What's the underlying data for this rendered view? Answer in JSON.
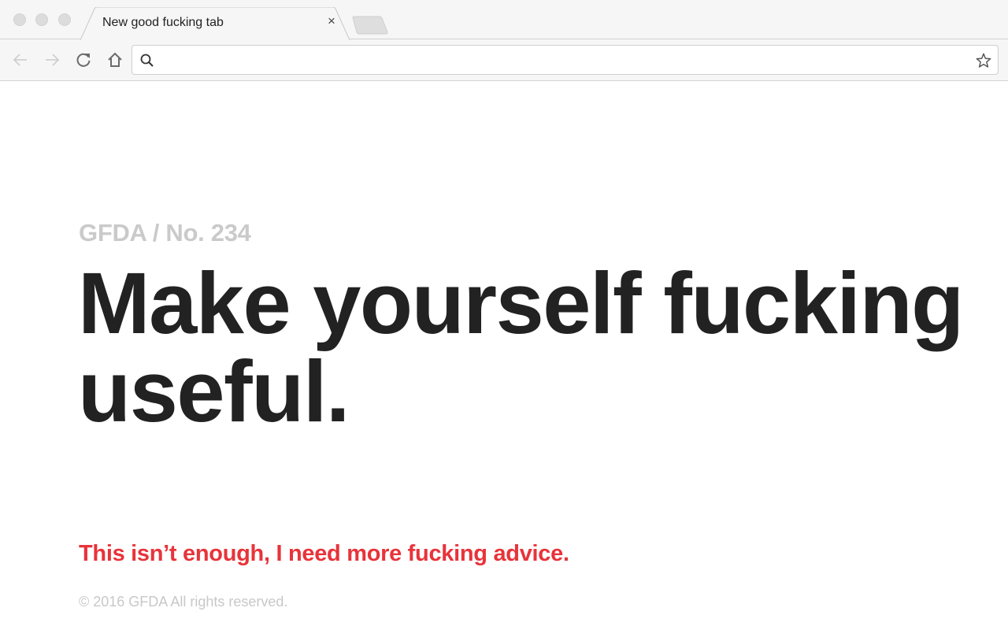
{
  "browser": {
    "tab": {
      "title": "New good fucking tab",
      "close_glyph": "×"
    },
    "omnibox": {
      "value": "",
      "placeholder": ""
    },
    "icons": {
      "back": "arrow-left-icon",
      "forward": "arrow-right-icon",
      "reload": "reload-icon",
      "home": "home-icon",
      "search": "search-icon",
      "bookmark": "star-icon"
    }
  },
  "page": {
    "issue_label": "GFDA / No. 234",
    "headline": "Make yourself fucking useful.",
    "more_advice_link": "This isn’t enough, I need more fucking advice.",
    "copyright": "© 2016 GFDA All rights reserved."
  },
  "colors": {
    "accent_red": "#e8333a",
    "headline": "#222222",
    "muted": "#cacaca"
  }
}
